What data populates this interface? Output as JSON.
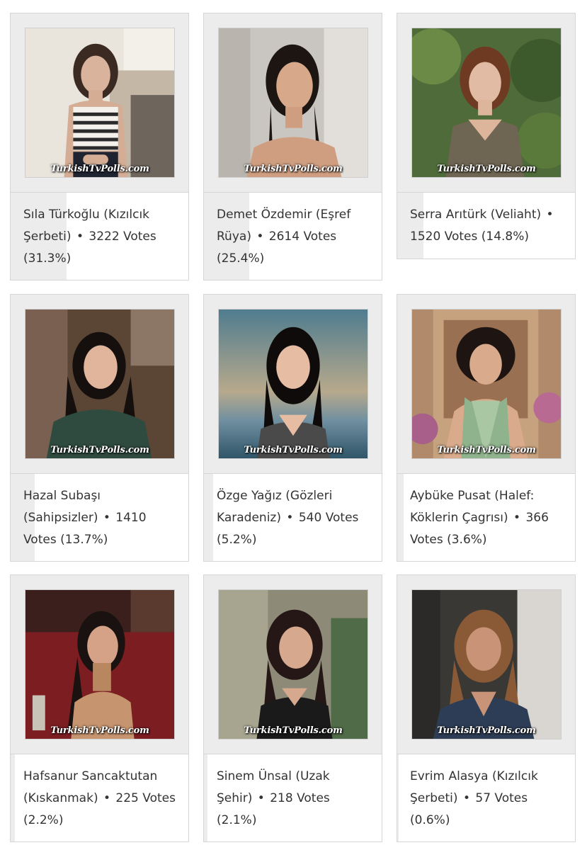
{
  "watermark": "TurkishTvPolls.com",
  "bullet": "•",
  "cards": [
    {
      "name": "Sıla Türkoğlu",
      "show": "Kızılcık Şerbeti",
      "votes": 3222,
      "votes_text": "3222 Votes",
      "percent": 31.3,
      "percent_text": "(31.3%)"
    },
    {
      "name": "Demet Özdemir",
      "show": "Eşref Rüya",
      "votes": 2614,
      "votes_text": "2614 Votes",
      "percent": 25.4,
      "percent_text": "(25.4%)"
    },
    {
      "name": "Serra Arıtürk",
      "show": "Veliaht",
      "votes": 1520,
      "votes_text": "1520 Votes",
      "percent": 14.8,
      "percent_text": "(14.8%)"
    },
    {
      "name": "Hazal Subaşı",
      "show": "Sahipsizler",
      "votes": 1410,
      "votes_text": "1410 Votes",
      "percent": 13.7,
      "percent_text": "(13.7%)"
    },
    {
      "name": "Özge Yağız",
      "show": "Gözleri Karadeniz",
      "votes": 540,
      "votes_text": "540 Votes",
      "percent": 5.2,
      "percent_text": "(5.2%)"
    },
    {
      "name": "Aybüke Pusat",
      "show": "Halef: Köklerin Çagrısı",
      "votes": 366,
      "votes_text": "366 Votes",
      "percent": 3.6,
      "percent_text": "(3.6%)"
    },
    {
      "name": "Hafsanur Sancaktutan",
      "show": "Kıskanmak",
      "votes": 225,
      "votes_text": "225 Votes",
      "percent": 2.2,
      "percent_text": "(2.2%)"
    },
    {
      "name": "Sinem Ünsal",
      "show": "Uzak Şehir",
      "votes": 218,
      "votes_text": "218 Votes",
      "percent": 2.1,
      "percent_text": "(2.1%)"
    },
    {
      "name": "Evrim Alasya",
      "show": "Kızılcık Şerbeti",
      "votes": 57,
      "votes_text": "57 Votes",
      "percent": 0.6,
      "percent_text": "(0.6%)"
    }
  ],
  "palette": {
    "bar_fill": "#ececec",
    "border": "#d6d6d6",
    "text": "#333333"
  }
}
